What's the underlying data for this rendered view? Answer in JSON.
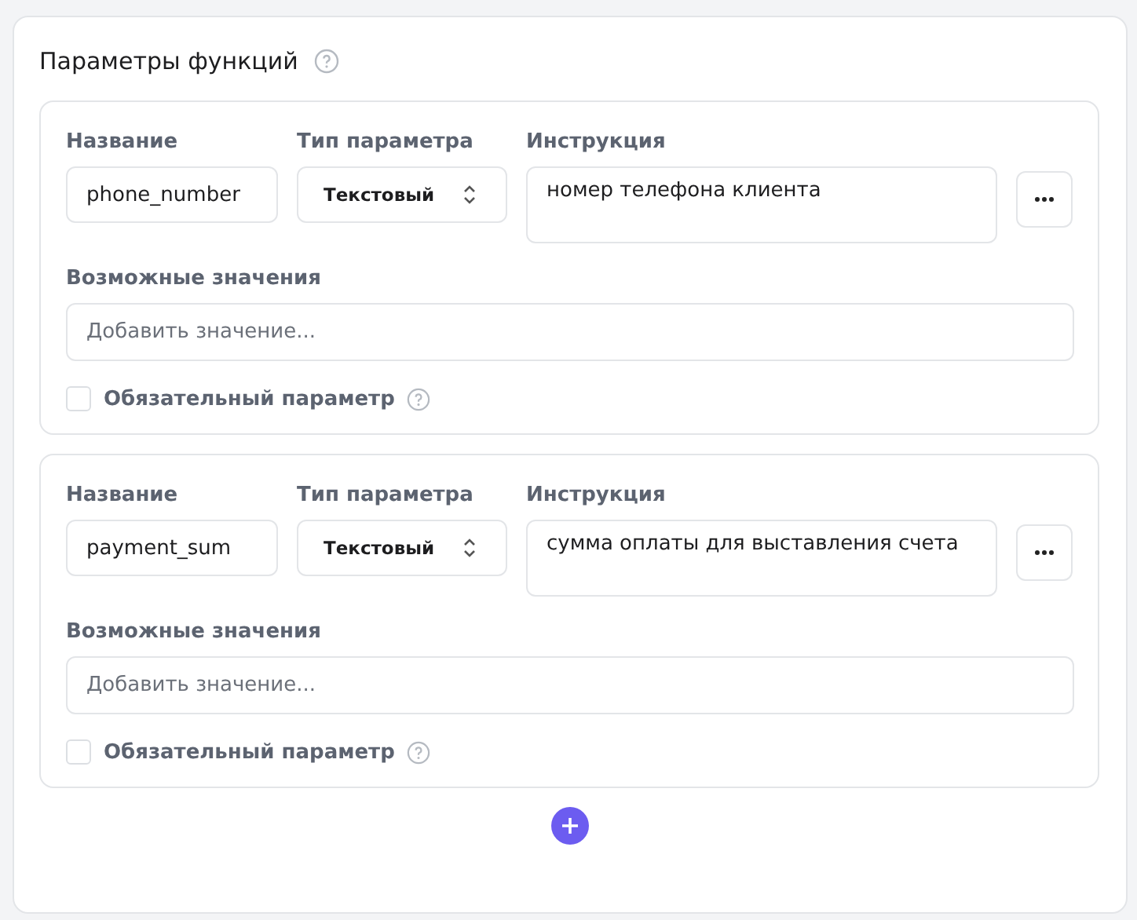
{
  "section": {
    "title": "Параметры функций"
  },
  "parameters": [
    {
      "name_label": "Название",
      "name_value": "phone_number",
      "type_label": "Тип параметра",
      "type_value": "Текстовый",
      "instruction_label": "Инструкция",
      "instruction_value": "номер телефона клиента",
      "values_label": "Возможные значения",
      "values_placeholder": "Добавить значение...",
      "required_label": "Обязательный параметр",
      "required": false
    },
    {
      "name_label": "Название",
      "name_value": "payment_sum",
      "type_label": "Тип параметра",
      "type_value": "Текстовый",
      "instruction_label": "Инструкция",
      "instruction_value": "сумма оплаты для выставления счета",
      "values_label": "Возможные значения",
      "values_placeholder": "Добавить значение...",
      "required_label": "Обязательный параметр",
      "required": false
    }
  ]
}
